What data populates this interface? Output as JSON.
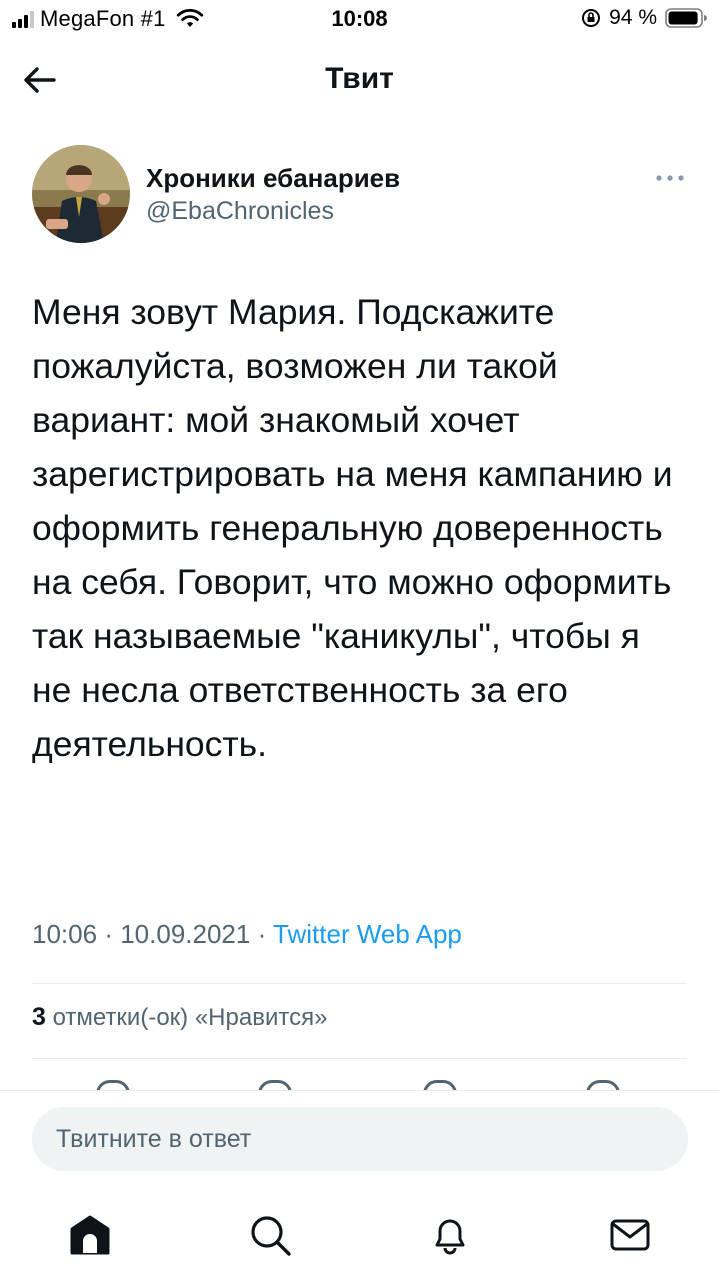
{
  "status_bar": {
    "carrier": "MegaFon #1",
    "time": "10:08",
    "battery_percent": "94 %",
    "battery_level": 0.94,
    "icons": [
      "signal-icon",
      "wifi-icon",
      "orientation-lock-icon",
      "battery-icon"
    ]
  },
  "header": {
    "title": "Твит",
    "back_icon": "arrow-left-icon"
  },
  "tweet": {
    "author_name": "Хроники ебанариев",
    "author_handle": "@EbaChronicles",
    "more_icon": "more-horizontal-icon",
    "text": "Меня зовут Мария. Подскажите пожалуйста, возможен ли такой вариант: мой знакомый хочет зарегистрировать на меня кампанию и оформить генеральную доверенность на себя. Говорит, что можно оформить так называемые \"каникулы\", чтобы я не несла ответственность за его деятельность.",
    "time": "10:06",
    "date": "10.09.2021",
    "separator": "·",
    "source": "Twitter Web App",
    "likes_count": "3",
    "likes_label": "отметки(-ок) «Нравится»"
  },
  "reply": {
    "placeholder": "Твитните в ответ"
  },
  "tabbar": {
    "items": [
      "home-icon",
      "search-icon",
      "notifications-icon",
      "messages-icon"
    ]
  },
  "colors": {
    "text": "#0f1419",
    "secondary": "#536471",
    "accent": "#1d9bf0",
    "input_bg": "#eff3f4",
    "divider": "#e6ecf0"
  }
}
